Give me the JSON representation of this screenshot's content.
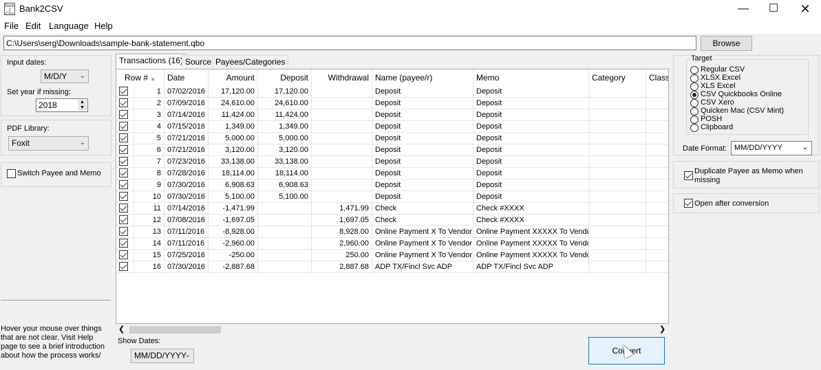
{
  "window": {
    "title": "Bank2CSV",
    "icon_text": "Bank\n2\nCSV",
    "icons": {
      "app": "app-icon",
      "minimize": "minimize-icon",
      "maximize": "maximize-icon",
      "close": "close-icon"
    }
  },
  "menu": {
    "items": [
      "File",
      "Edit",
      "Language",
      "Help"
    ]
  },
  "path": {
    "value": "C:\\Users\\serg\\Downloads\\sample-bank-statement.qbo",
    "browse_label": "Browse"
  },
  "left_panel": {
    "input_dates_label": "Input dates:",
    "input_dates_value": "M/D/Y",
    "set_year_label": "Set year if missing:",
    "year_value": "2018",
    "pdf_library_label": "PDF Library:",
    "pdf_library_value": "Foxit",
    "switch_payee_label": "Switch Payee and Memo",
    "switch_payee_checked": false,
    "help_text": "Hover your mouse over things that are not clear. Visit Help page to see a brief introduction about how the process works/"
  },
  "tabs": [
    "Transactions (16)",
    "Source",
    "Payees/Categories"
  ],
  "grid": {
    "columns": [
      "Row #",
      "Date",
      "Amount",
      "Deposit",
      "Withdrawal",
      "Name (payee/r)",
      "Memo",
      "Category",
      "Class"
    ],
    "rows": [
      {
        "n": "1",
        "date": "07/02/2016",
        "amount": "17,120.00",
        "deposit": "17,120.00",
        "withdrawal": "",
        "name": "Deposit",
        "memo": "Deposit"
      },
      {
        "n": "2",
        "date": "07/09/2016",
        "amount": "24,610.00",
        "deposit": "24,610.00",
        "withdrawal": "",
        "name": "Deposit",
        "memo": "Deposit"
      },
      {
        "n": "3",
        "date": "07/14/2016",
        "amount": "11,424.00",
        "deposit": "11,424.00",
        "withdrawal": "",
        "name": "Deposit",
        "memo": "Deposit"
      },
      {
        "n": "4",
        "date": "07/15/2016",
        "amount": "1,349.00",
        "deposit": "1,349.00",
        "withdrawal": "",
        "name": "Deposit",
        "memo": "Deposit"
      },
      {
        "n": "5",
        "date": "07/21/2016",
        "amount": "5,000.00",
        "deposit": "5,000.00",
        "withdrawal": "",
        "name": "Deposit",
        "memo": "Deposit"
      },
      {
        "n": "6",
        "date": "07/21/2016",
        "amount": "3,120.00",
        "deposit": "3,120.00",
        "withdrawal": "",
        "name": "Deposit",
        "memo": "Deposit"
      },
      {
        "n": "7",
        "date": "07/23/2016",
        "amount": "33,138.00",
        "deposit": "33,138.00",
        "withdrawal": "",
        "name": "Deposit",
        "memo": "Deposit"
      },
      {
        "n": "8",
        "date": "07/28/2016",
        "amount": "18,114.00",
        "deposit": "18,114.00",
        "withdrawal": "",
        "name": "Deposit",
        "memo": "Deposit"
      },
      {
        "n": "9",
        "date": "07/30/2016",
        "amount": "6,908.63",
        "deposit": "6,908.63",
        "withdrawal": "",
        "name": "Deposit",
        "memo": "Deposit"
      },
      {
        "n": "10",
        "date": "07/30/2016",
        "amount": "5,100.00",
        "deposit": "5,100.00",
        "withdrawal": "",
        "name": "Deposit",
        "memo": "Deposit"
      },
      {
        "n": "11",
        "date": "07/14/2016",
        "amount": "-1,471.99",
        "deposit": "",
        "withdrawal": "1,471.99",
        "name": "Check",
        "memo": "Check #XXXX"
      },
      {
        "n": "12",
        "date": "07/08/2016",
        "amount": "-1,697.05",
        "deposit": "",
        "withdrawal": "1,697.05",
        "name": "Check",
        "memo": "Check #XXXX"
      },
      {
        "n": "13",
        "date": "07/11/2016",
        "amount": "-8,928.00",
        "deposit": "",
        "withdrawal": "8,928.00",
        "name": "Online Payment X To Vendor",
        "memo": "Online Payment XXXXX To Vendor"
      },
      {
        "n": "14",
        "date": "07/11/2016",
        "amount": "-2,960.00",
        "deposit": "",
        "withdrawal": "2,960.00",
        "name": "Online Payment X To Vendor",
        "memo": "Online Payment XXXXX To Vendor"
      },
      {
        "n": "15",
        "date": "07/25/2016",
        "amount": "-250.00",
        "deposit": "",
        "withdrawal": "250.00",
        "name": "Online Payment X To Vendor",
        "memo": "Online Payment XXXXX To Vendor"
      },
      {
        "n": "16",
        "date": "07/30/2016",
        "amount": "-2,887.68",
        "deposit": "",
        "withdrawal": "2,887.68",
        "name": "ADP TX/Fincl Svc ADP",
        "memo": "ADP TX/Fincl Svc ADP"
      }
    ]
  },
  "bottom": {
    "show_dates_label": "Show Dates:",
    "show_dates_value": "MM/DD/YYYY",
    "convert_label": "Convert"
  },
  "right_panel": {
    "target_label": "Target",
    "targets": [
      "Regular CSV",
      "XLSX Excel",
      "XLS Excel",
      "CSV Quickbooks Online",
      "CSV Xero",
      "Quicken Mac (CSV Mint)",
      "POSH",
      "Clipboard"
    ],
    "selected_target": "CSV Quickbooks Online",
    "date_format_label": "Date Format:",
    "date_format_value": "MM/DD/YYYY",
    "duplicate_payee_label": "Duplicate Payee as Memo when missing",
    "duplicate_payee_checked": true,
    "open_after_label": "Open after conversion",
    "open_after_checked": true
  }
}
